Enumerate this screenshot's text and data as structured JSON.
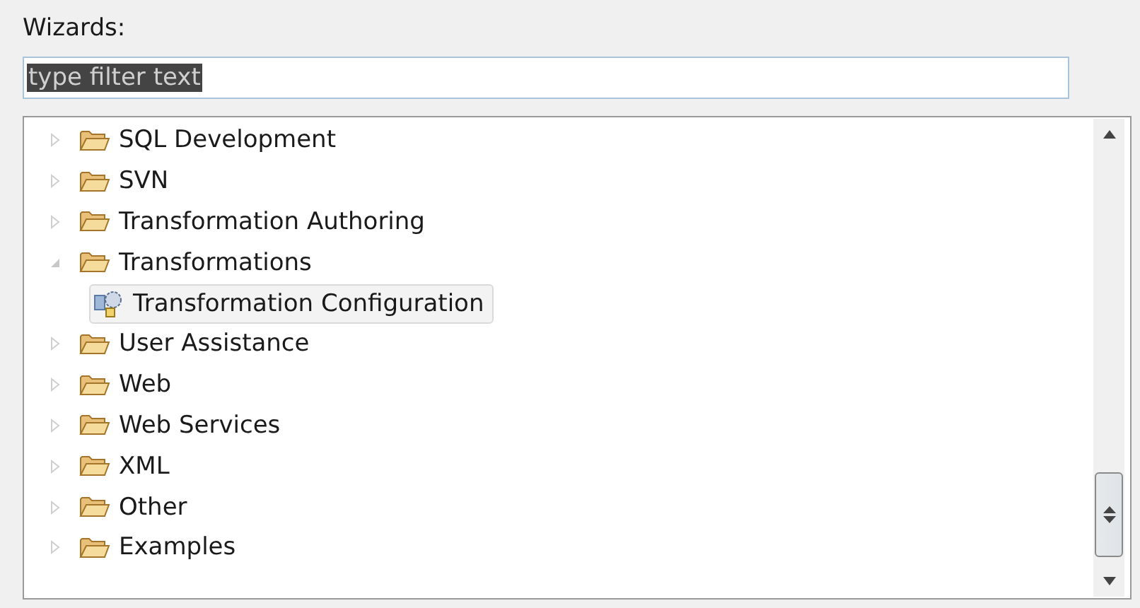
{
  "label": "Wizards:",
  "filter": {
    "value": "type filter text",
    "text_selected": true
  },
  "tree": [
    {
      "label": "SQL Development",
      "kind": "folder",
      "expanded": false,
      "selected": false
    },
    {
      "label": "SVN",
      "kind": "folder",
      "expanded": false,
      "selected": false
    },
    {
      "label": "Transformation Authoring",
      "kind": "folder",
      "expanded": false,
      "selected": false
    },
    {
      "label": "Transformations",
      "kind": "folder",
      "expanded": true,
      "selected": false,
      "children": [
        {
          "label": "Transformation Configuration",
          "kind": "wizard",
          "selected": true
        }
      ]
    },
    {
      "label": "User Assistance",
      "kind": "folder",
      "expanded": false,
      "selected": false
    },
    {
      "label": "Web",
      "kind": "folder",
      "expanded": false,
      "selected": false
    },
    {
      "label": "Web Services",
      "kind": "folder",
      "expanded": false,
      "selected": false
    },
    {
      "label": "XML",
      "kind": "folder",
      "expanded": false,
      "selected": false
    },
    {
      "label": "Other",
      "kind": "folder",
      "expanded": false,
      "selected": false
    },
    {
      "label": "Examples",
      "kind": "folder",
      "expanded": false,
      "selected": false
    }
  ]
}
